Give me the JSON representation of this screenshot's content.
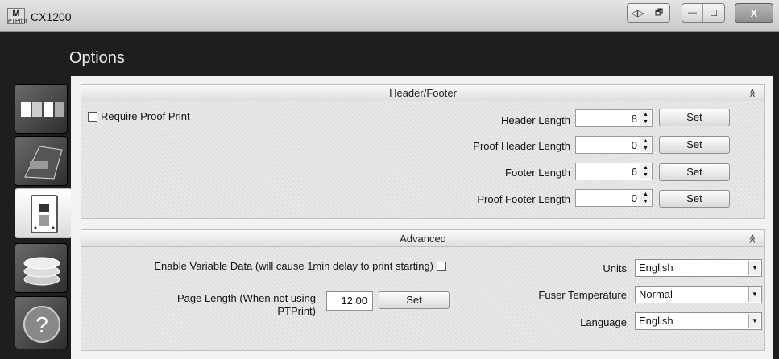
{
  "window": {
    "title": "CX1200",
    "app_icon_letter": "M",
    "app_icon_text": "PTPrint",
    "controls": [
      "◁▷",
      "🗗",
      "—",
      "☐"
    ],
    "close_label": "X"
  },
  "header": {
    "title": "Options"
  },
  "sidebar": {
    "items": [
      {
        "name": "ribbons",
        "icon": "ribbon-icon"
      },
      {
        "name": "printer",
        "icon": "printer-icon"
      },
      {
        "name": "options",
        "icon": "device-icon",
        "active": true
      },
      {
        "name": "coins",
        "icon": "coins-icon"
      },
      {
        "name": "help",
        "icon": "help-icon",
        "glyph": "?"
      }
    ]
  },
  "header_footer": {
    "title": "Header/Footer",
    "collapse_glyph": "≪",
    "require_proof_label": "Require Proof Print",
    "rows": [
      {
        "label": "Header Length",
        "value": "8",
        "button": "Set"
      },
      {
        "label": "Proof Header Length",
        "value": "0",
        "button": "Set"
      },
      {
        "label": "Footer Length",
        "value": "6",
        "button": "Set"
      },
      {
        "label": "Proof Footer Length",
        "value": "0",
        "button": "Set"
      }
    ]
  },
  "advanced": {
    "title": "Advanced",
    "collapse_glyph": "≪",
    "variable_data_label": "Enable Variable Data (will cause 1min delay to print starting)",
    "page_length_label_1": "Page Length (When not using",
    "page_length_label_2": "PTPrint)",
    "page_length_value": "12.00",
    "page_length_button": "Set",
    "units_label": "Units",
    "units_value": "English",
    "fuser_label": "Fuser Temperature",
    "fuser_value": "Normal",
    "language_label": "Language",
    "language_value": "English"
  }
}
